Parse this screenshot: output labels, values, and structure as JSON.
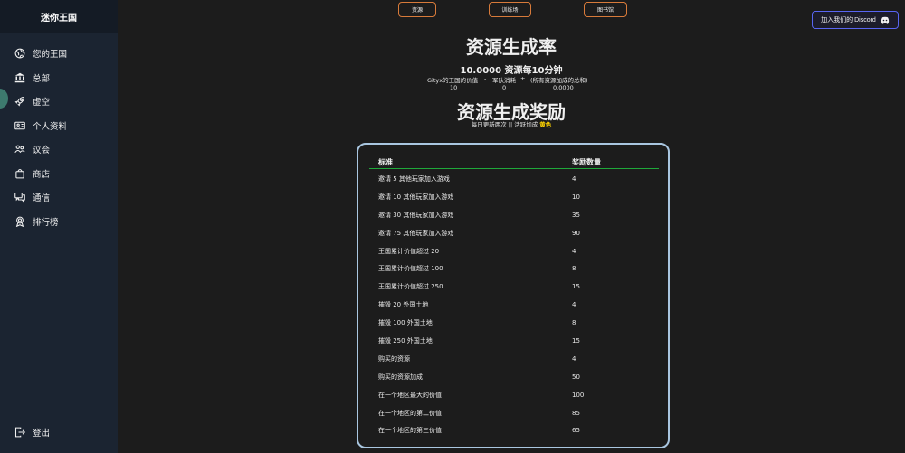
{
  "sidebar": {
    "brand": "迷你王国",
    "items": [
      {
        "label": "您的王国",
        "icon": "globe-icon"
      },
      {
        "label": "总部",
        "icon": "bank-icon"
      },
      {
        "label": "虚空",
        "icon": "rocket-icon"
      },
      {
        "label": "个人资料",
        "icon": "id-card-icon"
      },
      {
        "label": "议会",
        "icon": "people-icon"
      },
      {
        "label": "商店",
        "icon": "shopping-bag-icon"
      },
      {
        "label": "通信",
        "icon": "chat-icon"
      },
      {
        "label": "排行榜",
        "icon": "award-icon"
      }
    ],
    "logout": {
      "label": "登出",
      "icon": "logout-icon"
    }
  },
  "top_nav": {
    "resources": "资源",
    "training": "训练场",
    "library": "图书馆"
  },
  "discord": {
    "label": "加入我们的 Discord",
    "icon": "discord-icon"
  },
  "rate": {
    "title": "资源生成率",
    "amount": "10.0000 资源每10分钟",
    "formula_label_kingdom": "Gityx的王国的价值",
    "op_minus": "-",
    "formula_label_army": "军队消耗",
    "op_plus": "+",
    "formula_label_bonus": "(所有资源加成的总和)",
    "value_kingdom": "10",
    "value_army": "0",
    "value_bonus": "0.0000"
  },
  "bonus": {
    "title": "资源生成奖励",
    "subtitle_prefix": "每日更新两次 || 活跃加成",
    "subtitle_color": "黄色",
    "columns": [
      "标准",
      "奖励数量"
    ],
    "rows": [
      [
        "邀请 5 其他玩家加入游戏",
        "4"
      ],
      [
        "邀请 10 其他玩家加入游戏",
        "10"
      ],
      [
        "邀请 30 其他玩家加入游戏",
        "35"
      ],
      [
        "邀请 75 其他玩家加入游戏",
        "90"
      ],
      [
        "王国累计价值超过 20",
        "4"
      ],
      [
        "王国累计价值超过 100",
        "8"
      ],
      [
        "王国累计价值超过 250",
        "15"
      ],
      [
        "摧毁 20 外国土地",
        "4"
      ],
      [
        "摧毁 100 外国土地",
        "8"
      ],
      [
        "摧毁 250 外国土地",
        "15"
      ],
      [
        "购买的资源",
        "4"
      ],
      [
        "购买的资源加成",
        "50"
      ],
      [
        "在一个地区最大的价值",
        "100"
      ],
      [
        "在一个地区的第二价值",
        "85"
      ],
      [
        "在一个地区的第三价值",
        "65"
      ]
    ]
  },
  "colors": {
    "accent_orange": "#d77a3a",
    "discord_blue": "#5865f2",
    "table_border": "#a9c6e0",
    "header_line": "#1fa83a",
    "highlight": "#ffd400"
  }
}
